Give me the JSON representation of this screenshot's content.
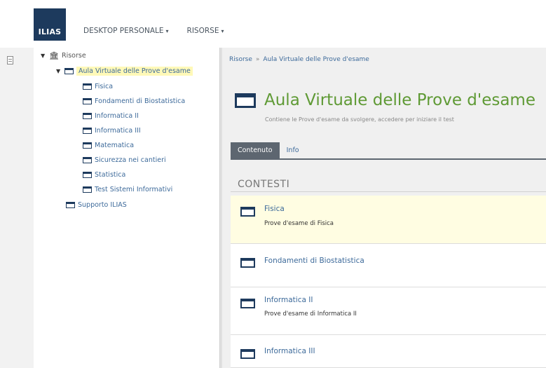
{
  "header": {
    "logo": "ILIAS",
    "nav": [
      {
        "label": "DESKTOP PERSONALE"
      },
      {
        "label": "RISORSE"
      }
    ]
  },
  "tree": {
    "root": "Risorse",
    "selected": "Aula Virtuale delle Prove d'esame",
    "children": [
      "Fisica",
      "Fondamenti di Biostatistica",
      "Informatica II",
      "Informatica III",
      "Matematica",
      "Sicurezza nei cantieri",
      "Statistica",
      "Test Sistemi Informativi"
    ],
    "sibling": "Supporto ILIAS"
  },
  "main": {
    "breadcrumb": [
      "Risorse",
      "Aula Virtuale delle Prove d'esame"
    ],
    "breadcrumb_sep": "»",
    "title": "Aula Virtuale delle Prove d'esame",
    "description": "Contiene le Prove d'esame da svolgere, accedere per iniziare il test",
    "tabs": [
      {
        "label": "Contenuto",
        "active": true
      },
      {
        "label": "Info",
        "active": false
      }
    ],
    "section": "CONTESTI",
    "items": [
      {
        "title": "Fisica",
        "subtitle": "Prove d'esame di Fisica"
      },
      {
        "title": "Fondamenti di Biostatistica",
        "subtitle": ""
      },
      {
        "title": "Informatica II",
        "subtitle": "Prove d'esame di Informatica II"
      },
      {
        "title": "Informatica III",
        "subtitle": ""
      }
    ]
  },
  "colors": {
    "brand_dark": "#1d3a5d",
    "title_green": "#5f9a35",
    "link_blue": "#3d6a9a",
    "highlight_yellow": "#fff9b8",
    "tab_active": "#5d6670"
  }
}
